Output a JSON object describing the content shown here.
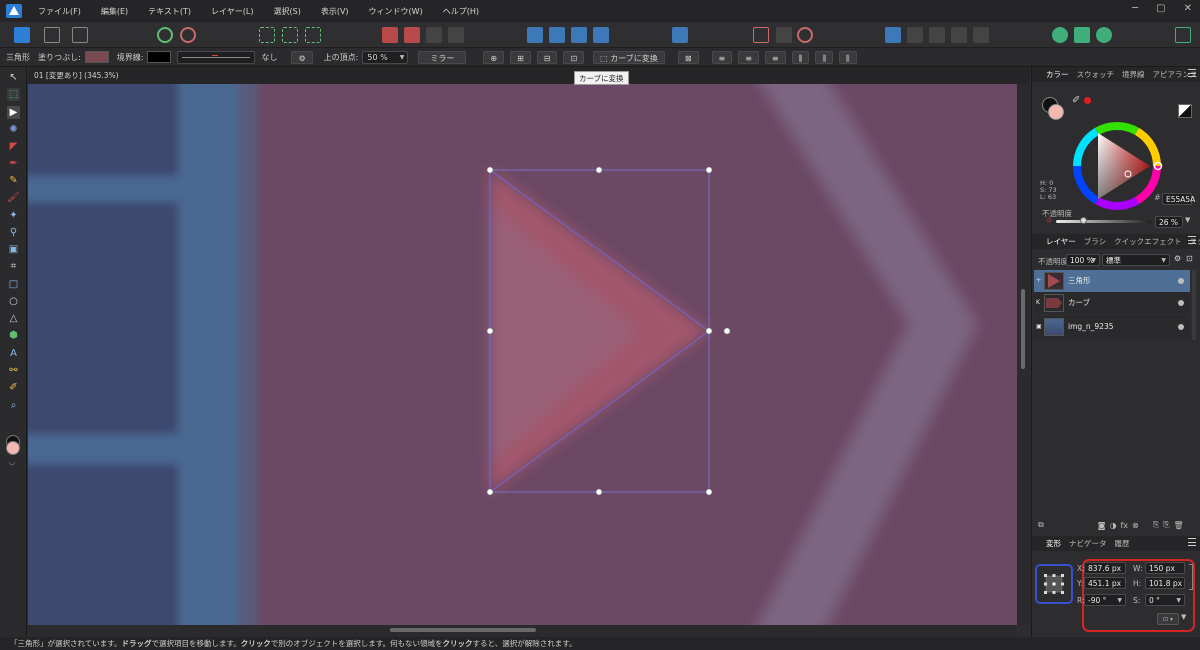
{
  "menubar": {
    "items": [
      "ファイル(F)",
      "編集(E)",
      "テキスト(T)",
      "レイヤー(L)",
      "選択(S)",
      "表示(V)",
      "ウィンドウ(W)",
      "ヘルプ(H)"
    ]
  },
  "context_bar": {
    "shape_name": "三角形",
    "fill_label": "塗りつぶし:",
    "stroke_label": "境界線:",
    "stroke_style": "なし",
    "top_vertex_label": "上の頂点:",
    "top_vertex_value": "50 %",
    "mirror_label": "ミラー",
    "convert_to_curves_label": "カーブに変換",
    "fill_color": "#7a4a52",
    "stroke_color": "#000000"
  },
  "tooltip": "カーブに変換",
  "document": {
    "tab_title": "01 [変更あり] (345.3%)"
  },
  "statusbar": {
    "prefix": "「三角形」が選択されています。",
    "drag": "ドラッグ",
    "t1": "で選択項目を移動します。",
    "click1": "クリック",
    "t2": "で別のオブジェクトを選択します。何もない領域を",
    "click2": "クリック",
    "t3": "すると、選択が解除されます。"
  },
  "color_panel": {
    "tabs": [
      "カラー",
      "スウォッチ",
      "境界線",
      "アピアランス"
    ],
    "h_label": "H: 0",
    "s_label": "S: 73",
    "l_label": "L: 63",
    "hex": "E55A5A",
    "opacity_label": "不透明度",
    "opacity_value": "26 %",
    "current_color": "#f4b8b0"
  },
  "layers_panel": {
    "tabs": [
      "レイヤー",
      "ブラシ",
      "クイックエフェクト",
      "スタイル"
    ],
    "opacity_label": "不透明度:",
    "opacity_value": "100 %",
    "blend_mode": "標準",
    "layers": [
      {
        "name": "三角形",
        "selected": true
      },
      {
        "name": "カーブ",
        "selected": false
      },
      {
        "name": "img_n_9235",
        "selected": false
      }
    ]
  },
  "transform_panel": {
    "tabs": [
      "変形",
      "ナビゲータ",
      "履歴"
    ],
    "x_label": "X:",
    "x_value": "837.6 px",
    "w_label": "W:",
    "w_value": "150 px",
    "y_label": "Y:",
    "y_value": "451.1 px",
    "h_label": "H:",
    "h_value": "101.8 px",
    "r_label": "R:",
    "r_value": "-90 °",
    "s_label": "S:",
    "s_value": "0 °"
  }
}
